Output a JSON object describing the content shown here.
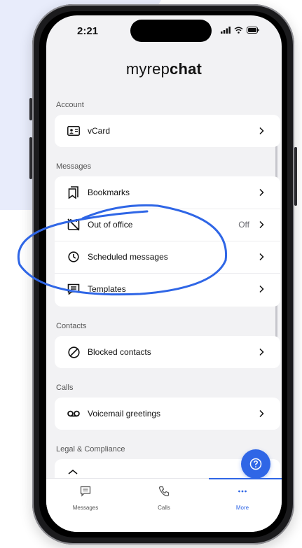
{
  "status": {
    "time": "2:21"
  },
  "brand": {
    "prefix": "myrep",
    "suffix": "chat"
  },
  "sections": {
    "account": {
      "label": "Account",
      "items": [
        {
          "label": "vCard",
          "icon": "vcard-icon"
        }
      ]
    },
    "messages": {
      "label": "Messages",
      "items": [
        {
          "label": "Bookmarks",
          "icon": "bookmarks-icon"
        },
        {
          "label": "Out of office",
          "icon": "out-of-office-icon",
          "value": "Off"
        },
        {
          "label": "Scheduled messages",
          "icon": "clock-icon"
        },
        {
          "label": "Templates",
          "icon": "templates-icon"
        }
      ]
    },
    "contacts": {
      "label": "Contacts",
      "items": [
        {
          "label": "Blocked contacts",
          "icon": "blocked-icon"
        }
      ]
    },
    "calls": {
      "label": "Calls",
      "items": [
        {
          "label": "Voicemail greetings",
          "icon": "voicemail-icon"
        }
      ]
    },
    "legal": {
      "label": "Legal & Compliance"
    }
  },
  "tabs": [
    {
      "label": "Messages",
      "icon": "message-icon"
    },
    {
      "label": "Calls",
      "icon": "phone-icon"
    },
    {
      "label": "More",
      "icon": "more-icon",
      "active": true
    }
  ],
  "colors": {
    "accent": "#2f66e6",
    "background_shape": "#e8ecfb"
  }
}
